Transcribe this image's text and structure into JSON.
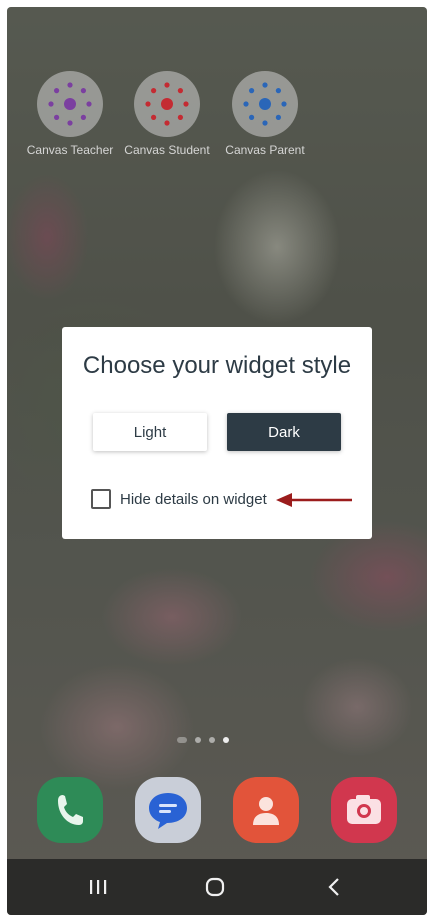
{
  "home_apps": [
    {
      "label": "Canvas Teacher",
      "icon": "canvas-teacher-icon",
      "color": "#7b3fa0"
    },
    {
      "label": "Canvas Student",
      "icon": "canvas-student-icon",
      "color": "#c42b32"
    },
    {
      "label": "Canvas Parent",
      "icon": "canvas-parent-icon",
      "color": "#2a66b8"
    }
  ],
  "dialog": {
    "title": "Choose your widget style",
    "light_label": "Light",
    "dark_label": "Dark",
    "checkbox_label": "Hide details on widget",
    "checkbox_checked": false,
    "annotation_arrow_color": "#9b1c1c"
  },
  "dock": [
    {
      "icon": "phone-icon",
      "color": "#2e8b57"
    },
    {
      "icon": "messages-icon",
      "color": "#2962d4"
    },
    {
      "icon": "contacts-icon",
      "color": "#e2543a"
    },
    {
      "icon": "camera-icon",
      "color": "#d1374e"
    }
  ],
  "nav": {
    "recents": "recent-apps-icon",
    "home": "home-icon",
    "back": "back-icon"
  }
}
